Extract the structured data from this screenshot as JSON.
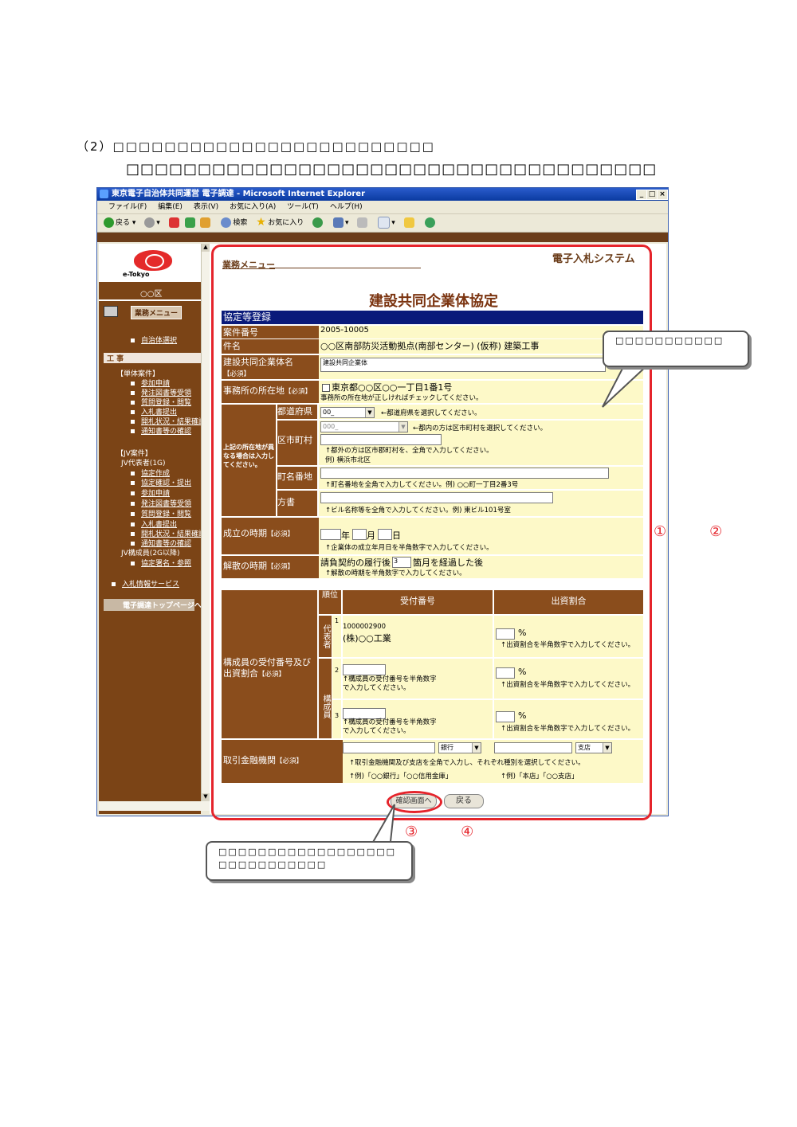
{
  "doc": {
    "heading_num": "（2）",
    "heading_text": "□□□□□□□□□□□□□□□□□□□□□□□□□",
    "subheading": "□□□□□□□□□□□□□□□□□□□□□□□□□□□□□□□□□□□□□",
    "label_a": "①　　　②",
    "label_b": "③　　　④"
  },
  "browser": {
    "title": "東京電子自治体共同運営 電子調達 - Microsoft Internet Explorer",
    "menus": [
      "ファイル(F)",
      "編集(E)",
      "表示(V)",
      "お気に入り(A)",
      "ツール(T)",
      "ヘルプ(H)"
    ],
    "back": "戻る",
    "search": "検索",
    "favorites": "お気に入り"
  },
  "sidebar": {
    "logo_text": "e-Tokyo",
    "org": "○○区",
    "menu_title": "業務メニュー",
    "municipality_select": "自治体選択",
    "section_works": "工 事",
    "single_label": "【単体案件】",
    "single_items": [
      "参加申請",
      "発注図書等受領",
      "質問登録・閲覧",
      "入札書提出",
      "開札状況・結果確認",
      "通知書等の確認"
    ],
    "jv_label": "【JV案件】",
    "jv_rep": "JV代表者(1G)",
    "jv_items": [
      "協定作成",
      "協定確認・提出",
      "参加申請",
      "発注図書等受領",
      "質問登録・閲覧",
      "入札書提出",
      "開札状況・結果確認",
      "通知書等の確認"
    ],
    "jv_member": "JV構成員(2G以降)",
    "jv_member_item": "協定署名・参照",
    "bid_info": "入札情報サービス",
    "top_page": "電子調達トップページへ"
  },
  "main": {
    "menu_link": "業務メニュー",
    "system_name": "電子入札システム",
    "page_title": "建設共同企業体協定",
    "section_header": "協定等登録",
    "case_no_label": "案件番号",
    "case_no": "2005-10005",
    "subject_label": "件名",
    "subject": "○○区南部防災活動拠点(南部センター) (仮称) 建築工事",
    "jv_name_label": "建設共同企業体名",
    "required": "【必須】",
    "jv_name_value": "建設共同企業体",
    "address_label": "事務所の所在地",
    "address_check": "東京都○○区○○一丁目1番1号",
    "address_note": "事務所の所在地が正しければチェックしてください。",
    "diff_address_label": "上記の所在地が異なる場合は入力してください。",
    "pref_label": "都道府県",
    "pref_value": "00_",
    "pref_note": "←都道府県を選択してください。",
    "city_label": "区市町村",
    "city_value": "000_",
    "city_note": "←都内の方は区市町村を選択してください。",
    "city_note2": "↑都外の方は区市郡町村を、全角で入力してください。",
    "city_example": "例) 横浜市北区",
    "street_label": "町名番地",
    "street_note": "↑町名番地を全角で入力してください。例) ○○町一丁目2番3号",
    "bldg_label": "方書",
    "bldg_note": "↑ビル名称等を全角で入力してください。例) 東ビル101号室",
    "established_label": "成立の時期",
    "year": "年",
    "month": "月",
    "day": "日",
    "established_note": "↑企業体の成立年月日を半角数字で入力してください。",
    "dissolve_label": "解散の時期",
    "dissolve_pre": "請負契約の履行後",
    "dissolve_value": "3",
    "dissolve_post": "箇月を経過した後",
    "dissolve_note": "↑解散の時期を半角数字で入力してください。",
    "members_label": "構成員の受付番号及び出資割合",
    "col_order": "順位",
    "col_receipt": "受付番号",
    "col_ratio": "出資割合",
    "rep_label": "代表者",
    "member_label": "構成員",
    "rep_receipt": "1000002900",
    "rep_company": "(株)○○工業",
    "percent": "%",
    "ratio_note": "↑出資割合を半角数字で入力してください。",
    "member_note": "↑構成員の受付番号を半角数字で入力してください。",
    "rows": [
      "1",
      "2",
      "3"
    ],
    "bank_label": "取引金融機関",
    "bank_type": "銀行",
    "branch_type": "支店",
    "bank_note": "↑取引金融機関及び支店を全角で入力し、それぞれ種別を選択してください。",
    "bank_example": "↑例)「○○銀行」「○○信用金庫」",
    "branch_example": "↑例)「本店」「○○支店」",
    "confirm_button": "確認画面へ",
    "back_button": "戻る"
  },
  "callouts": {
    "right": "□□□□□□□□□□□",
    "bottom_line1": "□□□□□□□□□□□□□□□□□□",
    "bottom_line2": "□□□□□□□□□□□"
  }
}
